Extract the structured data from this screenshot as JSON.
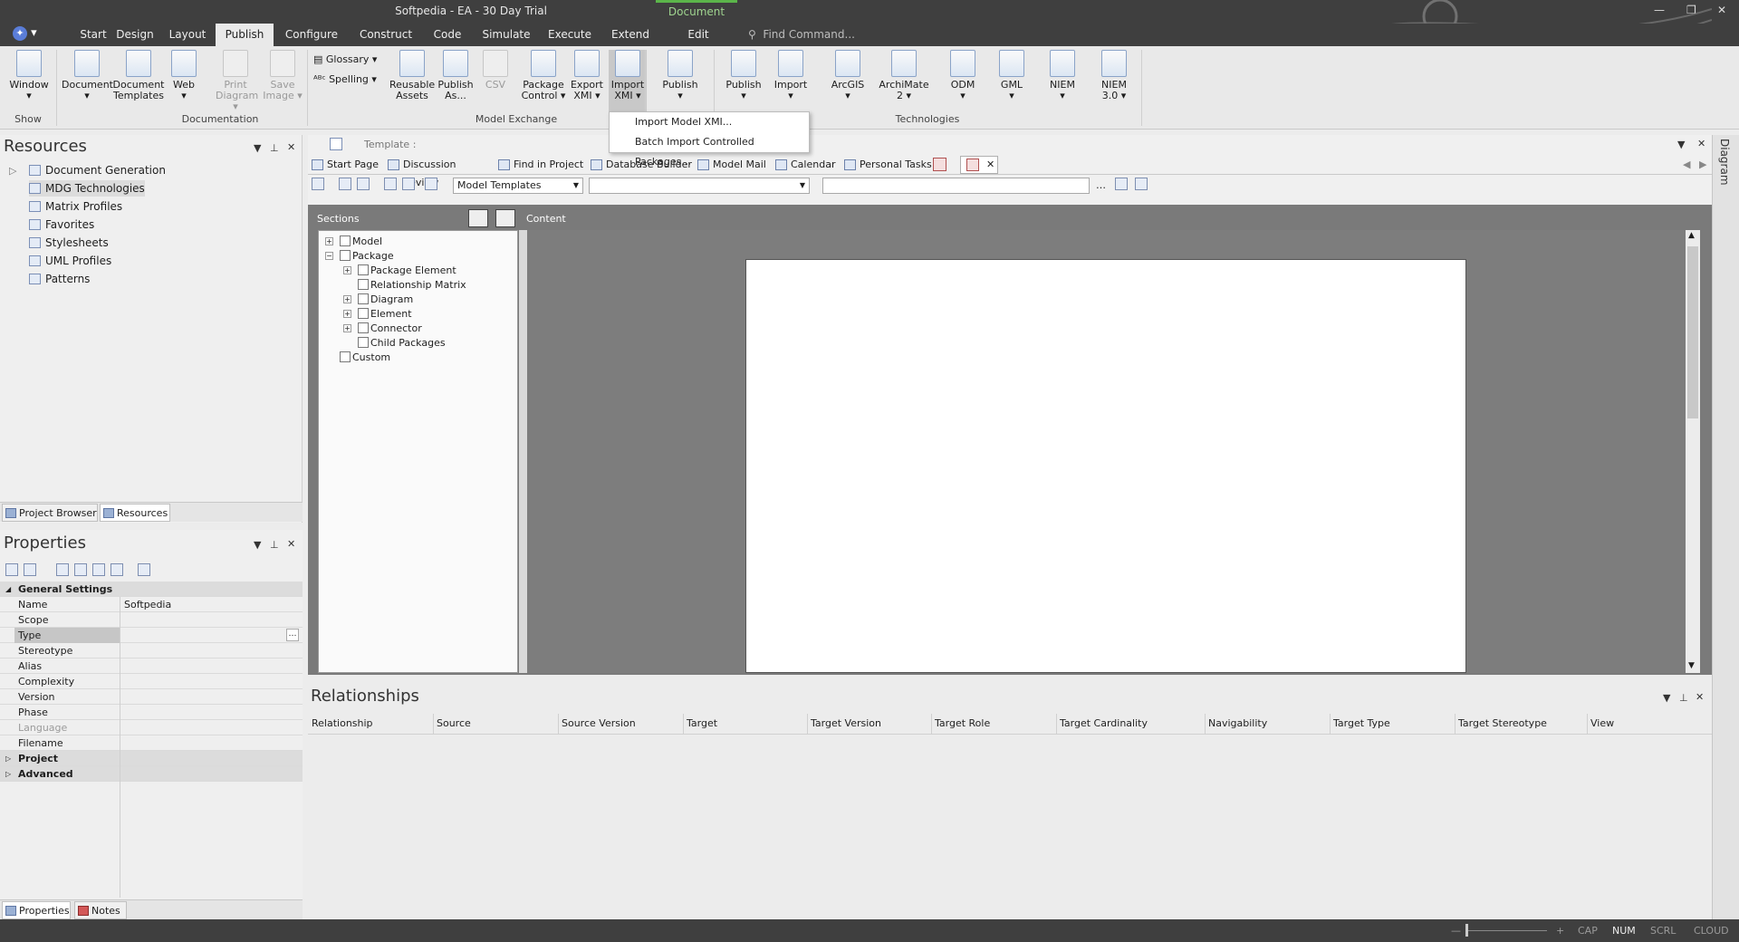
{
  "window": {
    "title": "Softpedia - EA - 30 Day Trial",
    "context_tab": "Document",
    "find_command": "Find Command..."
  },
  "menu": {
    "tabs": [
      "Start",
      "Design",
      "Layout",
      "Publish",
      "Configure",
      "Construct",
      "Code",
      "Simulate",
      "Execute",
      "Extend",
      "Edit"
    ],
    "active": "Publish"
  },
  "ribbon": {
    "buttons": [
      {
        "label": "Window",
        "line2": "▾"
      },
      {
        "label": "Document",
        "line2": "▾"
      },
      {
        "label": "Document",
        "line2": "Templates"
      },
      {
        "label": "Web",
        "line2": "▾"
      },
      {
        "label": "Print",
        "line2": "Diagram ▾"
      },
      {
        "label": "Save",
        "line2": "Image ▾"
      },
      {
        "label": "Reusable",
        "line2": "Assets"
      },
      {
        "label": "Publish",
        "line2": "As..."
      },
      {
        "label": "CSV",
        "line2": ""
      },
      {
        "label": "Package",
        "line2": "Control ▾"
      },
      {
        "label": "Export",
        "line2": "XMI ▾"
      },
      {
        "label": "Import",
        "line2": "XMI ▾"
      },
      {
        "label": "Publish",
        "line2": "▾"
      },
      {
        "label": "Publish",
        "line2": "▾"
      },
      {
        "label": "Import",
        "line2": "▾"
      },
      {
        "label": "ArcGIS",
        "line2": "▾"
      },
      {
        "label": "ArchiMate",
        "line2": "2 ▾"
      },
      {
        "label": "ODM",
        "line2": "▾"
      },
      {
        "label": "GML",
        "line2": "▾"
      },
      {
        "label": "NIEM",
        "line2": "▾"
      },
      {
        "label": "NIEM",
        "line2": "3.0 ▾"
      }
    ],
    "small": {
      "glossary": "Glossary ▾",
      "spelling": "Spelling ▾"
    },
    "groups": [
      "Show",
      "Documentation",
      "Model Exchange",
      "Technologies"
    ]
  },
  "dropdown": {
    "items": [
      "Import Model XMI...",
      "Batch Import Controlled Packages..."
    ]
  },
  "resources": {
    "title": "Resources",
    "items": [
      "Document Generation",
      "MDG Technologies",
      "Matrix Profiles",
      "Favorites",
      "Stylesheets",
      "UML Profiles",
      "Patterns"
    ],
    "selected": "MDG Technologies",
    "tabs": [
      "Project Browser",
      "Resources"
    ]
  },
  "properties": {
    "title": "Properties",
    "rows": [
      {
        "k": "General Settings",
        "v": "",
        "type": "sect"
      },
      {
        "k": "Name",
        "v": "Softpedia",
        "type": ""
      },
      {
        "k": "Scope",
        "v": "",
        "type": ""
      },
      {
        "k": "Type",
        "v": "",
        "type": "hl"
      },
      {
        "k": "Stereotype",
        "v": "",
        "type": ""
      },
      {
        "k": "Alias",
        "v": "",
        "type": ""
      },
      {
        "k": "Complexity",
        "v": "",
        "type": ""
      },
      {
        "k": "Version",
        "v": "",
        "type": ""
      },
      {
        "k": "Phase",
        "v": "",
        "type": ""
      },
      {
        "k": "Language",
        "v": "",
        "type": "gray"
      },
      {
        "k": "Filename",
        "v": "",
        "type": ""
      },
      {
        "k": "Project",
        "v": "",
        "type": "sect"
      },
      {
        "k": "Advanced",
        "v": "",
        "type": "sect"
      }
    ],
    "tabs": [
      "Properties",
      "Notes"
    ]
  },
  "document": {
    "template_label": "Template :",
    "tabs": [
      "Start Page",
      "Discussion Review",
      "Find in Project",
      "Database Builder",
      "Model Mail",
      "Calendar",
      "Personal Tasks"
    ],
    "model_templates": "Model Templates",
    "sections_label": "Sections",
    "content_label": "Content",
    "sections": [
      {
        "label": "Model",
        "level": 0,
        "exp": "+"
      },
      {
        "label": "Package",
        "level": 0,
        "exp": "−"
      },
      {
        "label": "Package Element",
        "level": 1,
        "exp": "+"
      },
      {
        "label": "Relationship Matrix",
        "level": 1,
        "exp": ""
      },
      {
        "label": "Diagram",
        "level": 1,
        "exp": "+"
      },
      {
        "label": "Element",
        "level": 1,
        "exp": "+"
      },
      {
        "label": "Connector",
        "level": 1,
        "exp": "+"
      },
      {
        "label": "Child Packages",
        "level": 1,
        "exp": ""
      },
      {
        "label": "Custom",
        "level": 0,
        "exp": ""
      }
    ]
  },
  "relationships": {
    "title": "Relationships",
    "columns": [
      "Relationship",
      "Source",
      "Source Version",
      "Target",
      "Target Version",
      "Target Role",
      "Target Cardinality",
      "Navigability",
      "Target Type",
      "Target Stereotype",
      "View"
    ]
  },
  "right_strip": {
    "label": "Diagram"
  },
  "status": {
    "caps": "CAP",
    "num": "NUM",
    "scrl": "SCRL",
    "cloud": "CLOUD"
  }
}
